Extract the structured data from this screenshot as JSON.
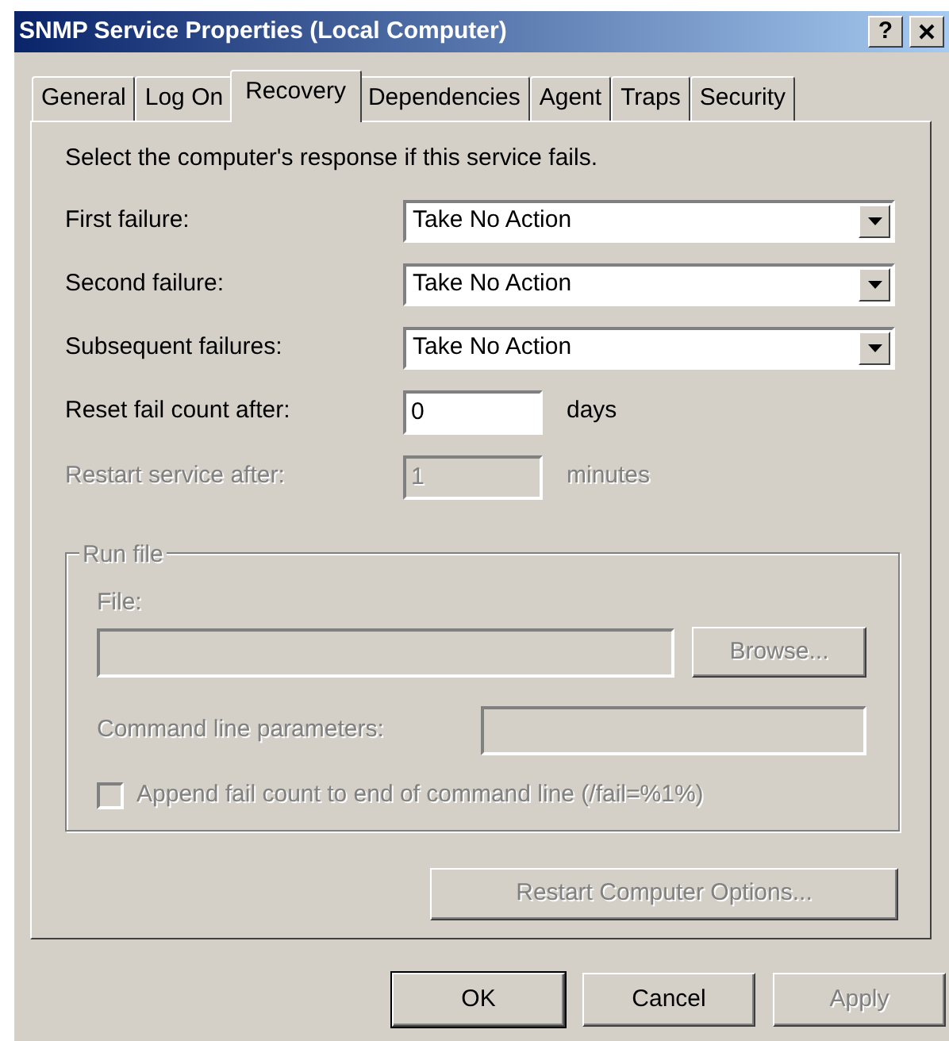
{
  "window": {
    "title": "SNMP Service Properties (Local Computer)",
    "help": "?"
  },
  "tabs": [
    {
      "label": "General",
      "selected": false
    },
    {
      "label": "Log On",
      "selected": false
    },
    {
      "label": "Recovery",
      "selected": true
    },
    {
      "label": "Dependencies",
      "selected": false
    },
    {
      "label": "Agent",
      "selected": false
    },
    {
      "label": "Traps",
      "selected": false
    },
    {
      "label": "Security",
      "selected": false
    }
  ],
  "intro": "Select the computer's response if this service fails.",
  "failures": [
    {
      "label": "First failure:",
      "value": "Take No Action"
    },
    {
      "label": "Second failure:",
      "value": "Take No Action"
    },
    {
      "label": "Subsequent failures:",
      "value": "Take No Action"
    }
  ],
  "counters": [
    {
      "label": "Reset fail count after:",
      "value": "0",
      "unit": "days",
      "disabled": false
    },
    {
      "label": "Restart service after:",
      "value": "1",
      "unit": "minutes",
      "disabled": true
    }
  ],
  "run_file": {
    "legend": "Run file",
    "disabled": true,
    "file_label": "File:",
    "browse": "Browse...",
    "params_label": "Command line parameters:",
    "append": {
      "label": "Append fail count to end of command line (/fail=%1%)",
      "checked": false
    }
  },
  "restart_options": {
    "label": "Restart Computer Options...",
    "disabled": true
  },
  "buttons": [
    {
      "label": "OK",
      "disabled": false
    },
    {
      "label": "Cancel",
      "disabled": false
    },
    {
      "label": "Apply",
      "disabled": true
    }
  ]
}
